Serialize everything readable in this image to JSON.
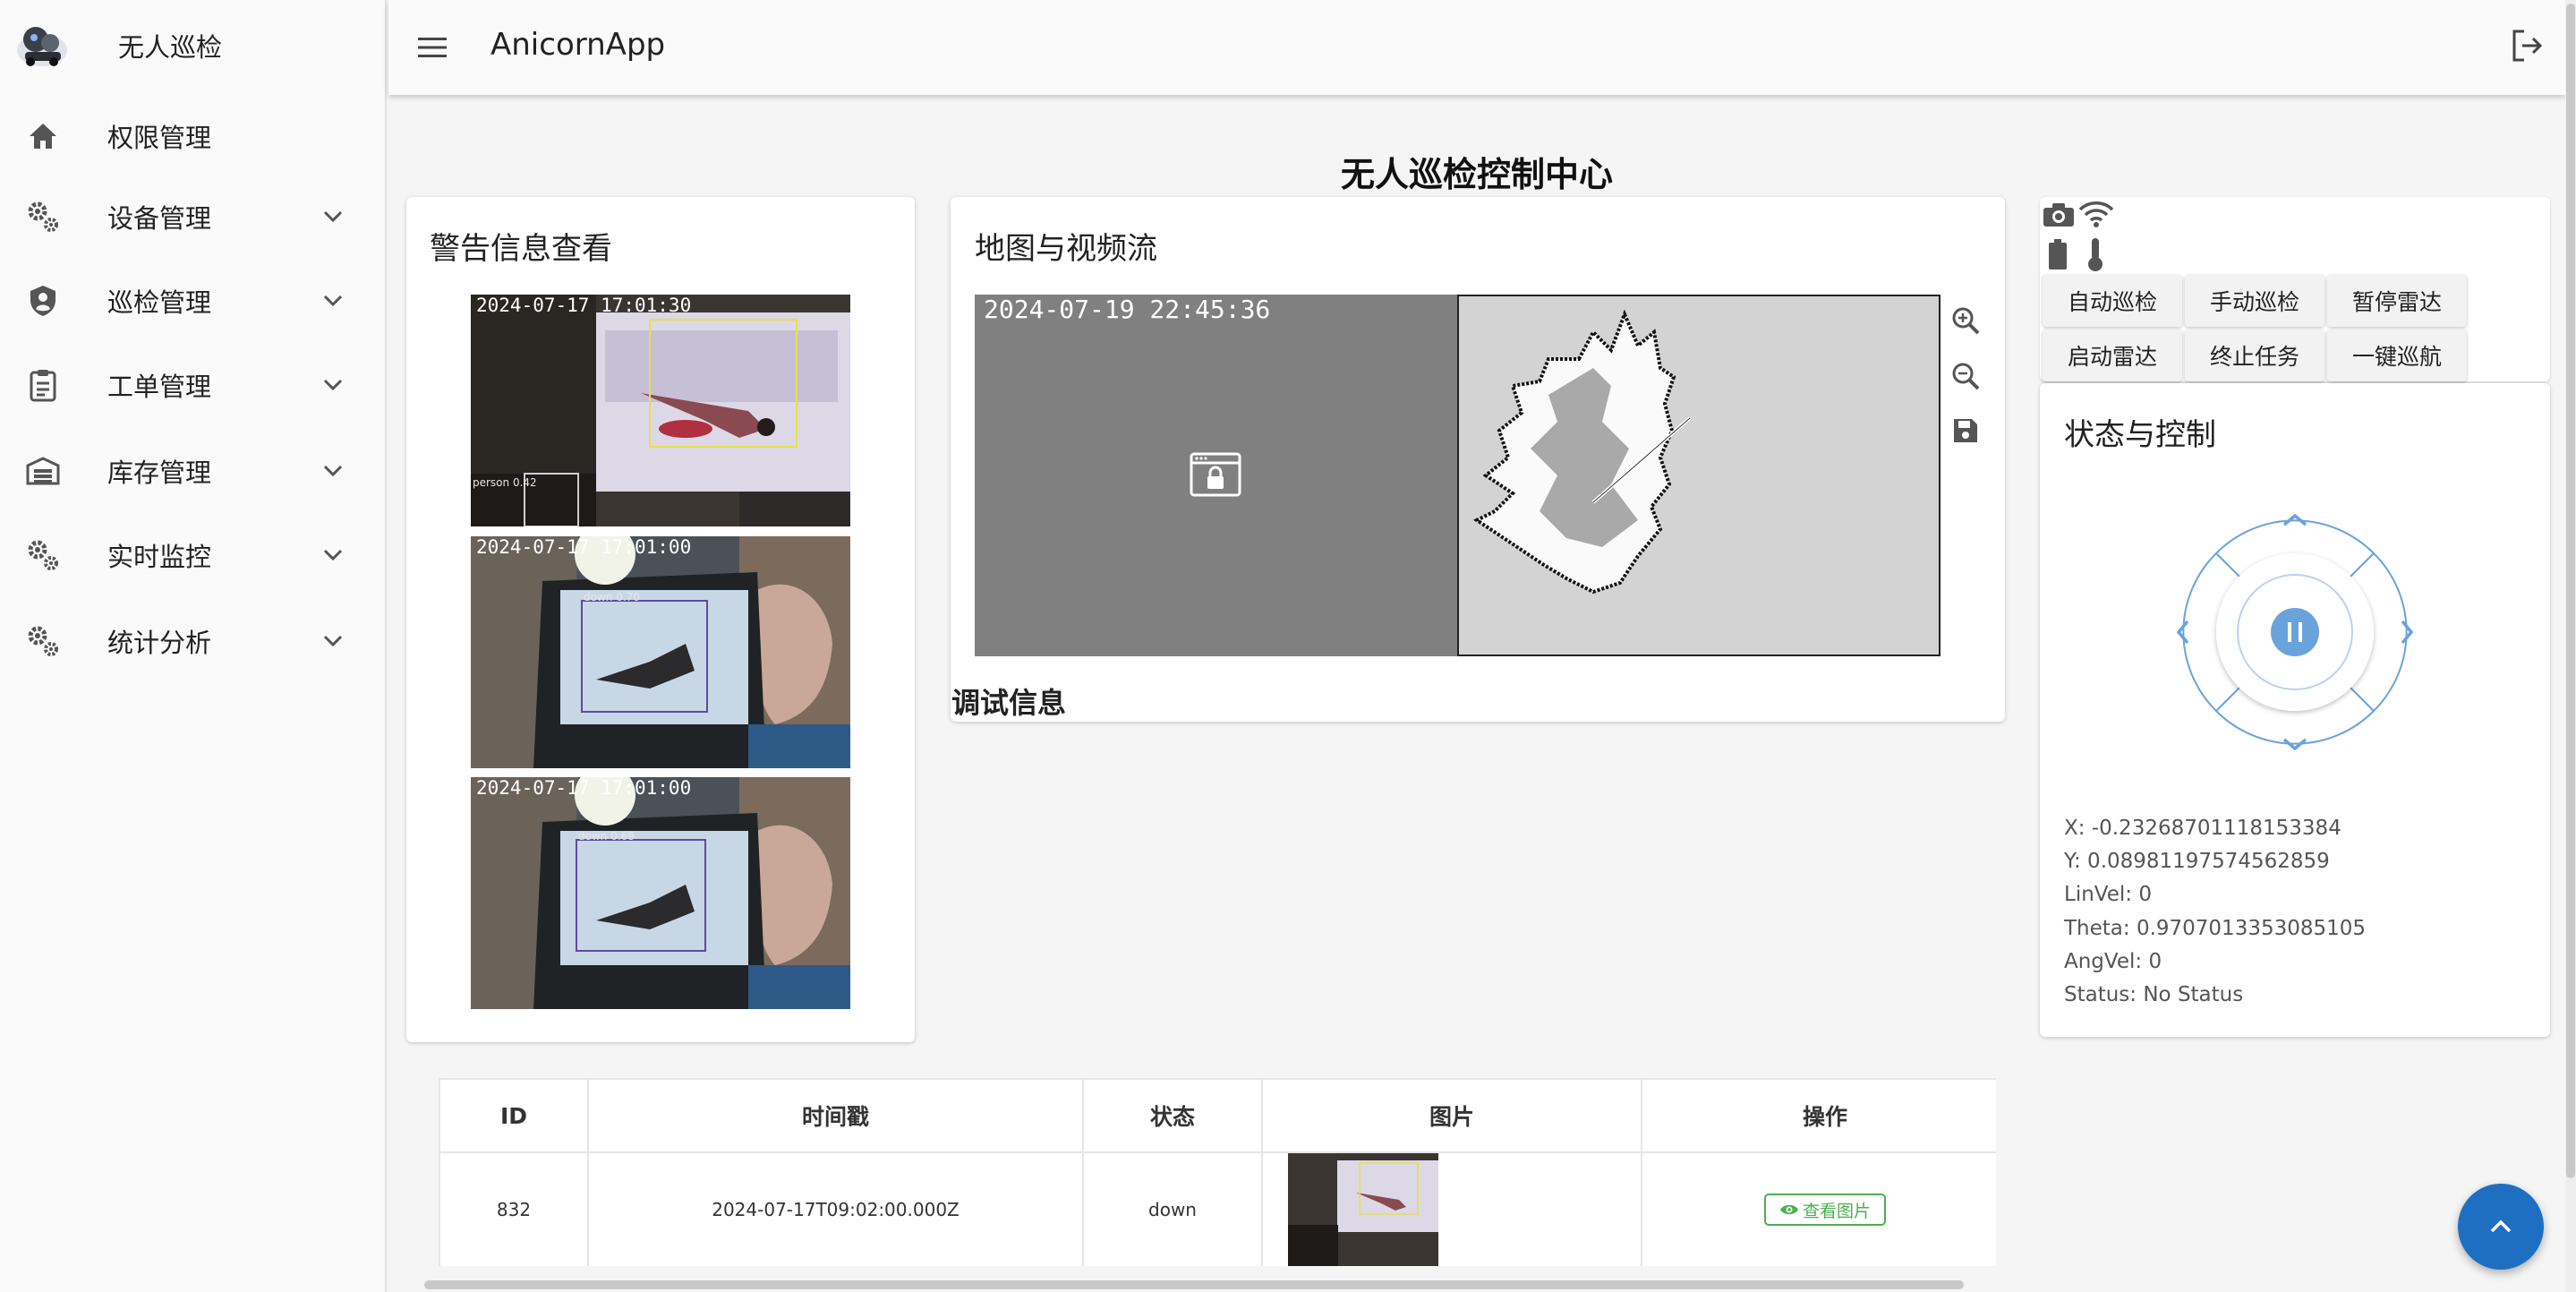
{
  "brand": {
    "name": "无人巡检"
  },
  "sidebar": {
    "items": [
      {
        "label": "权限管理",
        "icon": "home-icon",
        "expandable": false
      },
      {
        "label": "设备管理",
        "icon": "gears-icon",
        "expandable": true
      },
      {
        "label": "巡检管理",
        "icon": "shield-icon",
        "expandable": true
      },
      {
        "label": "工单管理",
        "icon": "clipboard-icon",
        "expandable": true
      },
      {
        "label": "库存管理",
        "icon": "warehouse-icon",
        "expandable": true
      },
      {
        "label": "实时监控",
        "icon": "gears-icon",
        "expandable": true
      },
      {
        "label": "统计分析",
        "icon": "gears-icon",
        "expandable": true
      }
    ]
  },
  "header": {
    "app_title": "AnicornApp",
    "menu_icon": "hamburger-icon",
    "logout_icon": "logout-icon"
  },
  "page": {
    "title": "无人巡检控制中心"
  },
  "alerts": {
    "title": "警告信息查看",
    "images": [
      {
        "timestamp": "2024-07-17 17:01:30",
        "detection_label": "person 0.42"
      },
      {
        "timestamp": "2024-07-17 17:01:00",
        "detection_label": "down 0.70"
      },
      {
        "timestamp": "2024-07-17 17:01:00",
        "detection_label": "down 0.68"
      }
    ]
  },
  "map": {
    "title": "地图与视频流",
    "video_timestamp": "2024-07-19 22:45:36",
    "video_lock_icon": "locked-window-icon",
    "tools": [
      "zoom-in-icon",
      "zoom-out-icon",
      "save-icon"
    ],
    "debug_title": "调试信息"
  },
  "control": {
    "status_icons": [
      "camera-icon",
      "wifi-icon",
      "battery-icon",
      "thermometer-icon"
    ],
    "buttons": [
      "自动巡检",
      "手动巡检",
      "暂停雷达",
      "启动雷达",
      "终止任务",
      "一键巡航"
    ],
    "title": "状态与控制",
    "readouts": {
      "x": "X: -0.23268701118153384",
      "y": "Y: 0.08981197574562859",
      "linvel": "LinVel: 0",
      "theta": "Theta: 0.9707013353085105",
      "angvel": "AngVel: 0",
      "status": "Status: No Status"
    }
  },
  "table": {
    "headers": [
      "ID",
      "时间戳",
      "状态",
      "图片",
      "操作"
    ],
    "rows": [
      {
        "id": "832",
        "timestamp": "2024-07-17T09:02:00.000Z",
        "status": "down",
        "action": "查看图片"
      }
    ]
  },
  "colors": {
    "accent": "#1e6fc2",
    "joystick": "#6aa3dc",
    "action_green": "#4caf50"
  }
}
